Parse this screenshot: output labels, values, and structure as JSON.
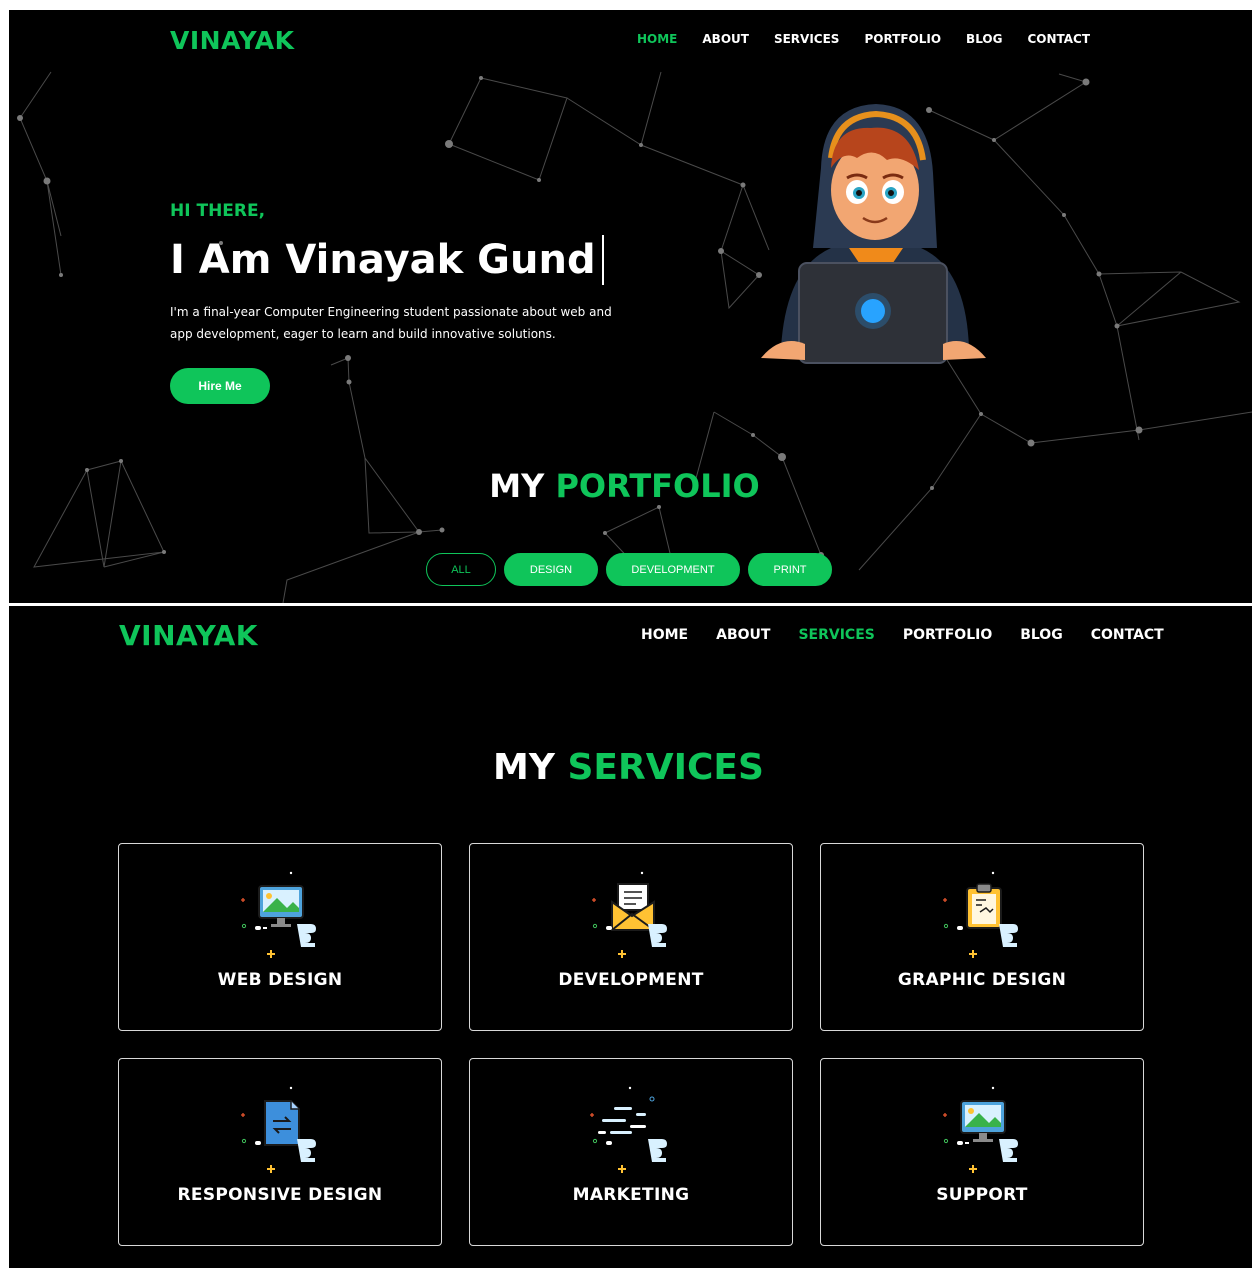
{
  "top_panel": {
    "logo": "VINAYAK",
    "nav": [
      {
        "label": "HOME",
        "active": true
      },
      {
        "label": "ABOUT",
        "active": false
      },
      {
        "label": "SERVICES",
        "active": false
      },
      {
        "label": "PORTFOLIO",
        "active": false
      },
      {
        "label": "BLOG",
        "active": false
      },
      {
        "label": "CONTACT",
        "active": false
      }
    ],
    "hero": {
      "greeting": "HI THERE,",
      "name": "I Am Vinayak Gund",
      "description": "I'm a final-year Computer Engineering student passionate about web and app development, eager to learn and build innovative solutions.",
      "cta": "Hire Me"
    },
    "portfolio": {
      "title_plain": "MY",
      "title_accent": "PORTFOLIO",
      "filters": [
        {
          "label": "ALL",
          "style": "outline"
        },
        {
          "label": "DESIGN",
          "style": "filled"
        },
        {
          "label": "DEVELOPMENT",
          "style": "filled"
        },
        {
          "label": "PRINT",
          "style": "filled"
        }
      ]
    }
  },
  "bottom_panel": {
    "logo": "VINAYAK",
    "nav": [
      {
        "label": "HOME",
        "active": false
      },
      {
        "label": "ABOUT",
        "active": false
      },
      {
        "label": "SERVICES",
        "active": true
      },
      {
        "label": "PORTFOLIO",
        "active": false
      },
      {
        "label": "BLOG",
        "active": false
      },
      {
        "label": "CONTACT",
        "active": false
      }
    ],
    "services": {
      "title_plain": "MY",
      "title_accent": "SERVICES",
      "items": [
        {
          "label": "WEB DESIGN",
          "icon": "monitor-image-icon"
        },
        {
          "label": "DEVELOPMENT",
          "icon": "envelope-icon"
        },
        {
          "label": "GRAPHIC DESIGN",
          "icon": "clipboard-icon"
        },
        {
          "label": "RESPONSIVE DESIGN",
          "icon": "file-sync-icon"
        },
        {
          "label": "MARKETING",
          "icon": "speed-lines-icon"
        },
        {
          "label": "SUPPORT",
          "icon": "monitor-image-icon"
        }
      ]
    }
  },
  "colors": {
    "accent": "#0fc55a",
    "background": "#000000",
    "text": "#ffffff"
  }
}
